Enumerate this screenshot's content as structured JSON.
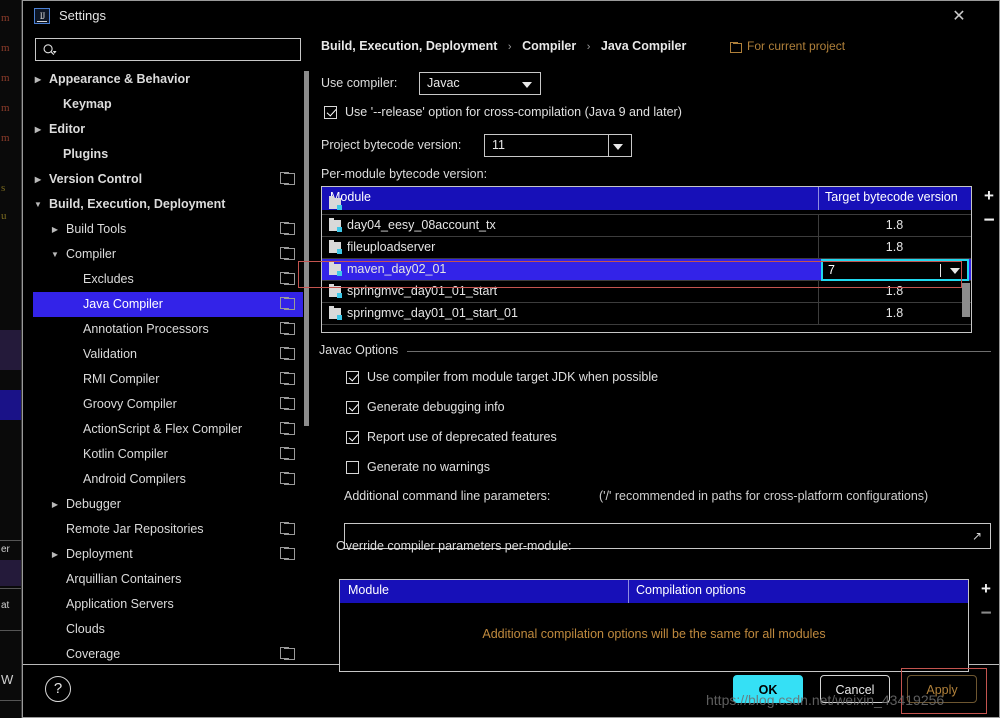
{
  "window": {
    "title": "Settings",
    "app_icon": "intellij-idea-icon",
    "close_icon": "close-icon"
  },
  "search": {
    "placeholder": "",
    "value": "",
    "icon": "search-icon"
  },
  "sidebar": {
    "items": [
      {
        "label": "Appearance & Behavior",
        "indent": 10,
        "arrow": "▶",
        "bold": true,
        "copy": false,
        "selected": false
      },
      {
        "label": "Keymap",
        "indent": 24,
        "arrow": "",
        "bold": true,
        "copy": false,
        "selected": false
      },
      {
        "label": "Editor",
        "indent": 10,
        "arrow": "▶",
        "bold": true,
        "copy": false,
        "selected": false
      },
      {
        "label": "Plugins",
        "indent": 24,
        "arrow": "",
        "bold": true,
        "copy": false,
        "selected": false
      },
      {
        "label": "Version Control",
        "indent": 10,
        "arrow": "▶",
        "bold": true,
        "copy": true,
        "selected": false
      },
      {
        "label": "Build, Execution, Deployment",
        "indent": 10,
        "arrow": "▼",
        "bold": true,
        "copy": false,
        "selected": false
      },
      {
        "label": "Build Tools",
        "indent": 27,
        "arrow": "▶",
        "bold": false,
        "copy": true,
        "selected": false
      },
      {
        "label": "Compiler",
        "indent": 27,
        "arrow": "▼",
        "bold": false,
        "copy": true,
        "selected": false
      },
      {
        "label": "Excludes",
        "indent": 44,
        "arrow": "",
        "bold": false,
        "copy": true,
        "selected": false
      },
      {
        "label": "Java Compiler",
        "indent": 44,
        "arrow": "",
        "bold": false,
        "copy": true,
        "selected": true
      },
      {
        "label": "Annotation Processors",
        "indent": 44,
        "arrow": "",
        "bold": false,
        "copy": true,
        "selected": false
      },
      {
        "label": "Validation",
        "indent": 44,
        "arrow": "",
        "bold": false,
        "copy": true,
        "selected": false
      },
      {
        "label": "RMI Compiler",
        "indent": 44,
        "arrow": "",
        "bold": false,
        "copy": true,
        "selected": false
      },
      {
        "label": "Groovy Compiler",
        "indent": 44,
        "arrow": "",
        "bold": false,
        "copy": true,
        "selected": false
      },
      {
        "label": "ActionScript & Flex Compiler",
        "indent": 44,
        "arrow": "",
        "bold": false,
        "copy": true,
        "selected": false
      },
      {
        "label": "Kotlin Compiler",
        "indent": 44,
        "arrow": "",
        "bold": false,
        "copy": true,
        "selected": false
      },
      {
        "label": "Android Compilers",
        "indent": 44,
        "arrow": "",
        "bold": false,
        "copy": true,
        "selected": false
      },
      {
        "label": "Debugger",
        "indent": 27,
        "arrow": "▶",
        "bold": false,
        "copy": false,
        "selected": false
      },
      {
        "label": "Remote Jar Repositories",
        "indent": 27,
        "arrow": "",
        "bold": false,
        "copy": true,
        "selected": false
      },
      {
        "label": "Deployment",
        "indent": 27,
        "arrow": "▶",
        "bold": false,
        "copy": true,
        "selected": false
      },
      {
        "label": "Arquillian Containers",
        "indent": 27,
        "arrow": "",
        "bold": false,
        "copy": false,
        "selected": false
      },
      {
        "label": "Application Servers",
        "indent": 27,
        "arrow": "",
        "bold": false,
        "copy": false,
        "selected": false
      },
      {
        "label": "Clouds",
        "indent": 27,
        "arrow": "",
        "bold": false,
        "copy": false,
        "selected": false
      },
      {
        "label": "Coverage",
        "indent": 27,
        "arrow": "",
        "bold": false,
        "copy": true,
        "selected": false
      }
    ]
  },
  "breadcrumb": {
    "part1": "Build, Execution, Deployment",
    "part2": "Compiler",
    "part3": "Java Compiler",
    "separator": "›"
  },
  "for_current_project": {
    "label": "For current project",
    "icon": "copy-scope-icon"
  },
  "compiler": {
    "use_compiler_label": "Use compiler:",
    "use_compiler_value": "Javac",
    "release_option_label": "Use '--release' option for cross-compilation (Java 9 and later)",
    "release_option_checked": true,
    "project_bytecode_label": "Project bytecode version:",
    "project_bytecode_value": "11",
    "per_module_label": "Per-module bytecode version:"
  },
  "module_table": {
    "columns": [
      "Module",
      "Target bytecode version"
    ],
    "rows": [
      {
        "name": "day04_eesy_08account_tx",
        "version": "1.8",
        "selected": false,
        "editing": false
      },
      {
        "name": "fileuploadserver",
        "version": "1.8",
        "selected": false,
        "editing": false
      },
      {
        "name": "maven_day02_01",
        "version": "7",
        "selected": true,
        "editing": true
      },
      {
        "name": "springmvc_day01_01_start",
        "version": "1.8",
        "selected": false,
        "editing": false
      },
      {
        "name": "springmvc_day01_01_start_01",
        "version": "1.8",
        "selected": false,
        "editing": false
      }
    ],
    "add_label": "+",
    "remove_label": "−"
  },
  "javac_options": {
    "group_label": "Javac Options",
    "checkboxes": [
      {
        "label": "Use compiler from module target JDK when possible",
        "checked": true
      },
      {
        "label": "Generate debugging info",
        "checked": true
      },
      {
        "label": "Report use of deprecated features",
        "checked": true
      },
      {
        "label": "Generate no warnings",
        "checked": false
      }
    ],
    "additional_params_label": "Additional command line parameters:",
    "additional_params_hint": "('/' recommended in paths for cross-platform configurations)",
    "additional_params_value": "",
    "expand_icon": "expand-icon"
  },
  "override_table": {
    "label": "Override compiler parameters per-module:",
    "columns": [
      "Module",
      "Compilation options"
    ],
    "empty_message": "Additional compilation options will be the same for all modules",
    "add_label": "+",
    "remove_label": "−"
  },
  "footer": {
    "help_label": "?",
    "ok_label": "OK",
    "cancel_label": "Cancel",
    "apply_label": "Apply",
    "watermark": "https://blog.csdn.net/weixin_43419256"
  },
  "colors": {
    "selection_blue": "#3323e8",
    "table_header_blue": "#1710b8",
    "editor_cyan": "#21d8ef",
    "ok_button_cyan": "#35e0f5",
    "accent_orange": "#b0803a",
    "annotation_red": "#c4544f"
  },
  "backdrop": {
    "glyphs": [
      "m",
      "m",
      "m",
      "m",
      "m",
      "s",
      "u",
      "er",
      "at",
      "W"
    ]
  }
}
